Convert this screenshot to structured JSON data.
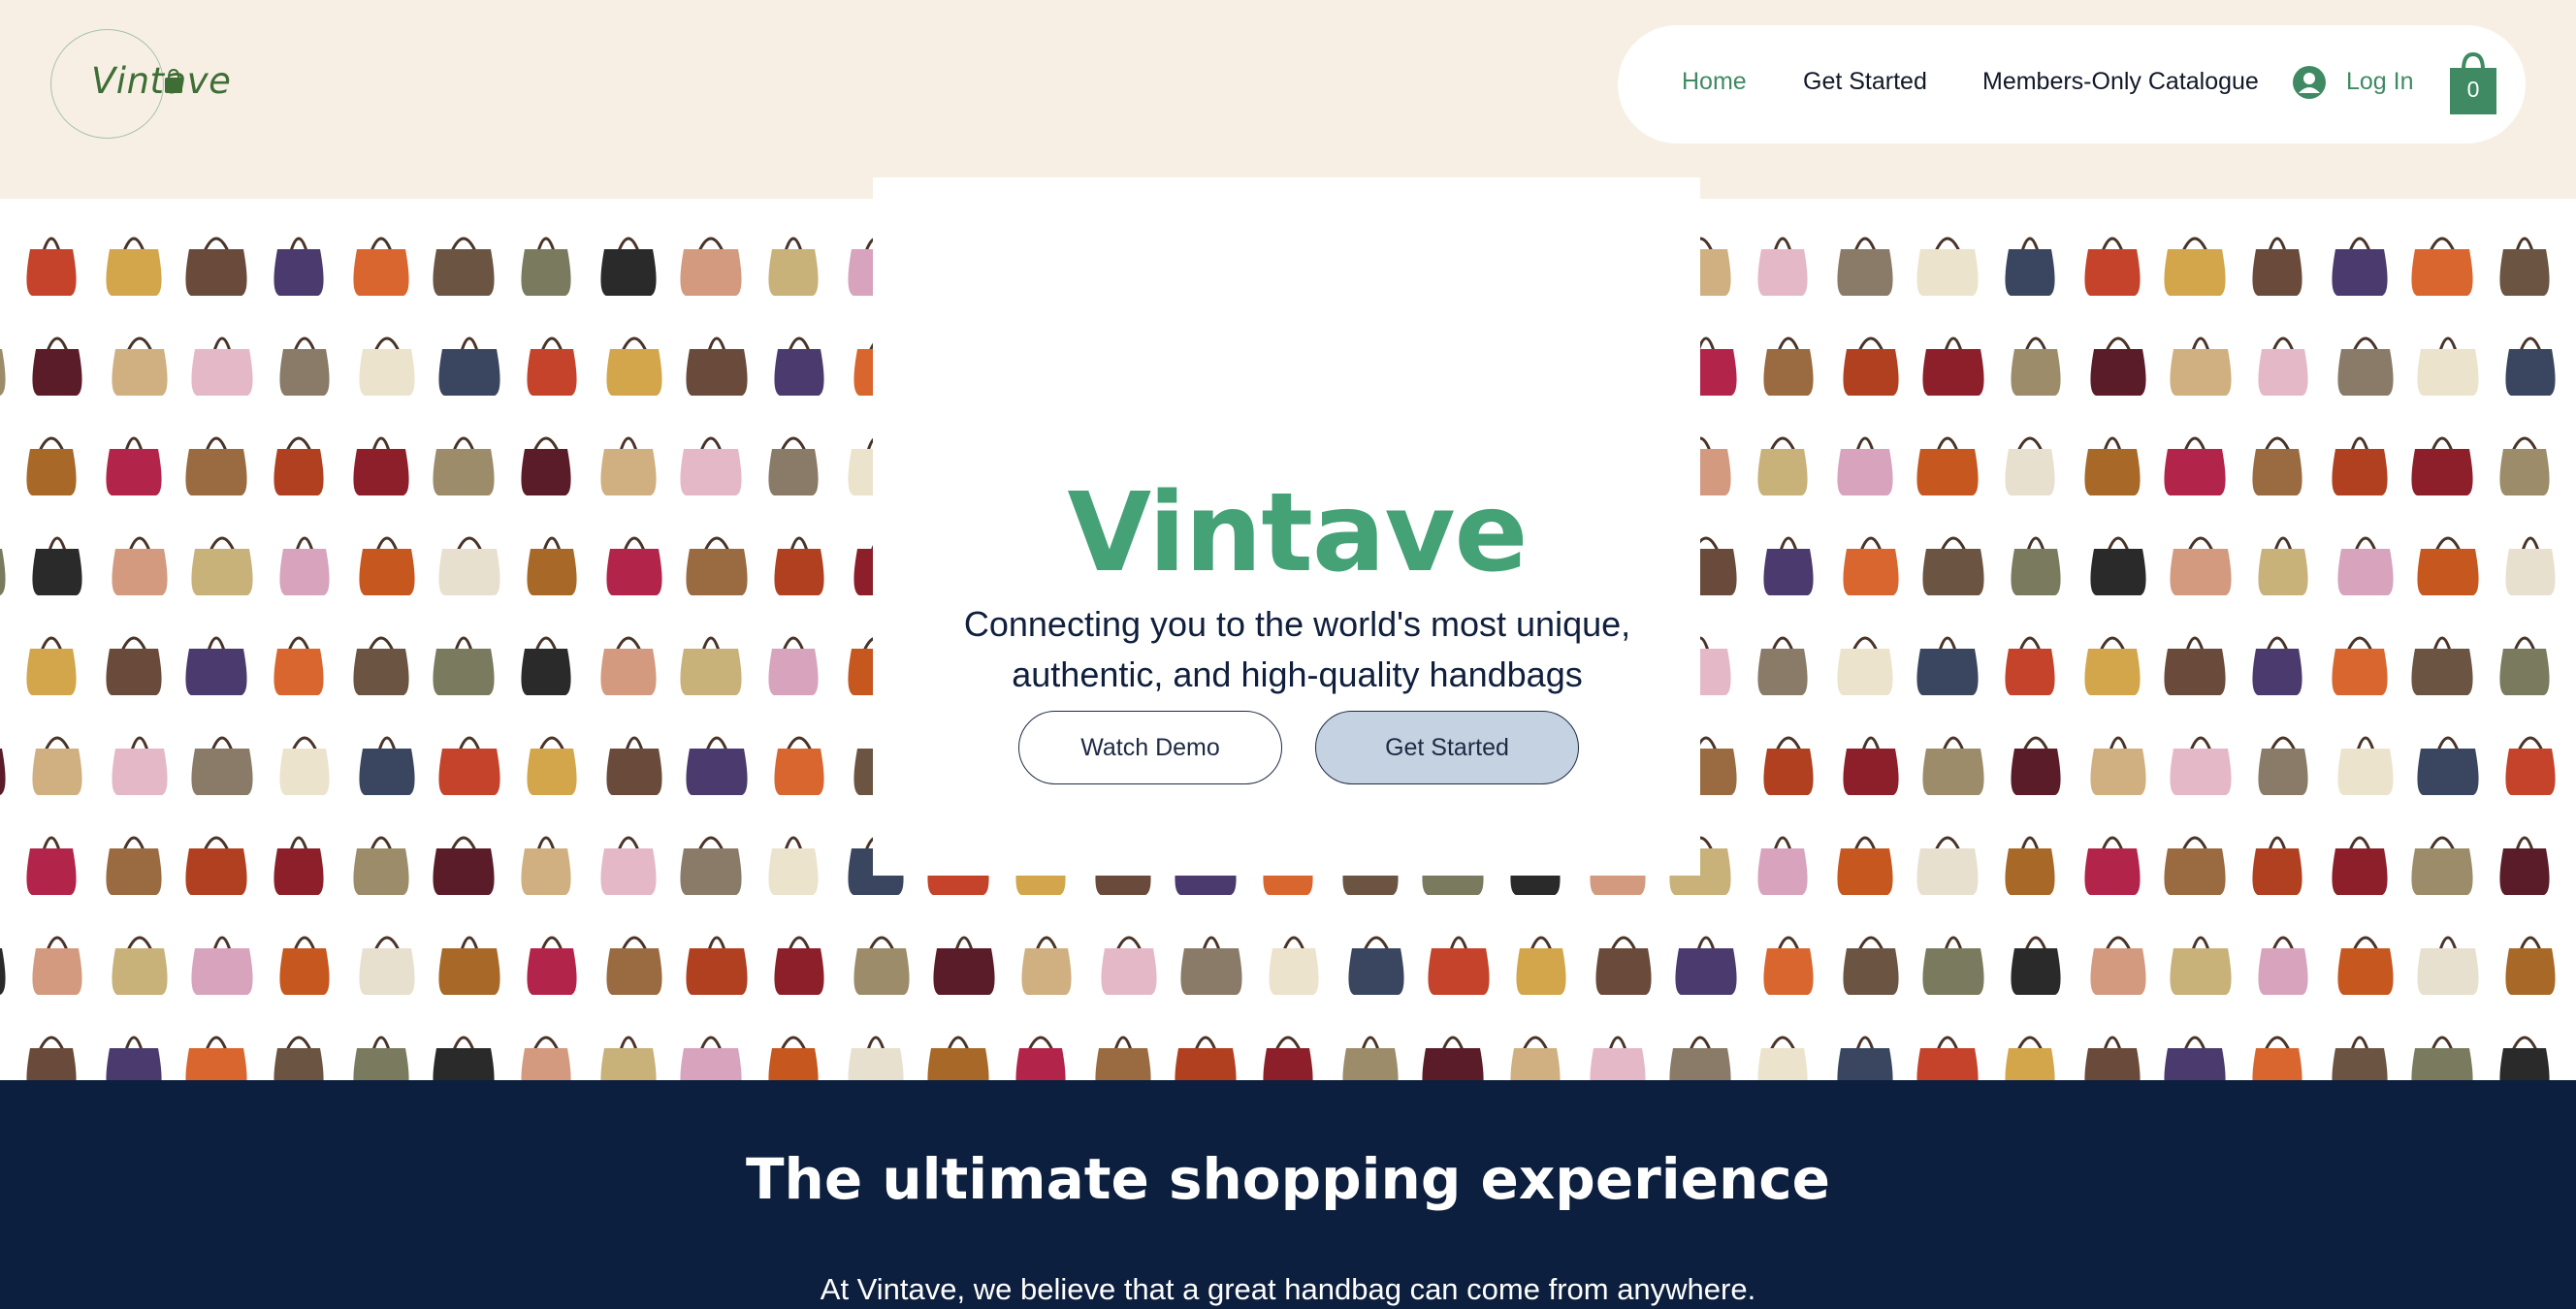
{
  "header": {
    "logo_text": "Vintave",
    "nav": [
      {
        "label": "Home",
        "active": true
      },
      {
        "label": "Get Started",
        "active": false
      },
      {
        "label": "Members-Only Catalogue",
        "active": false
      }
    ],
    "login_label": "Log In",
    "cart_count": "0"
  },
  "hero": {
    "title": "Vintave",
    "subtitle_line1": "Connecting you to the world's most unique,",
    "subtitle_line2": "authentic, and high-quality handbags",
    "watch_demo_label": "Watch Demo",
    "get_started_label": "Get Started",
    "background": "handbag-collage"
  },
  "section": {
    "title": "The ultimate shopping experience",
    "text": "At Vintave, we believe that a great handbag can come from anywhere."
  },
  "colors": {
    "header_bg": "#f7efe4",
    "accent_green": "#44a276",
    "nav_active": "#3f8a63",
    "navy": "#0d1f3e",
    "button_blue": "#c5d2e2"
  },
  "bag_palette": [
    "#c4432a",
    "#8c1f2a",
    "#c9b17a",
    "#d3a64c",
    "#9c8c6a",
    "#d7a3bd",
    "#6a4a3a",
    "#5a1c28",
    "#c5571f",
    "#4b3a6e",
    "#d0b080",
    "#e8e0cf",
    "#d9662e",
    "#e5b8c8",
    "#a86828",
    "#6b5442",
    "#8a7a68",
    "#b3244a",
    "#7a7a5e",
    "#ece3cd",
    "#9a6a40",
    "#2a2a2a",
    "#3a4660",
    "#b04020",
    "#d49a80"
  ]
}
